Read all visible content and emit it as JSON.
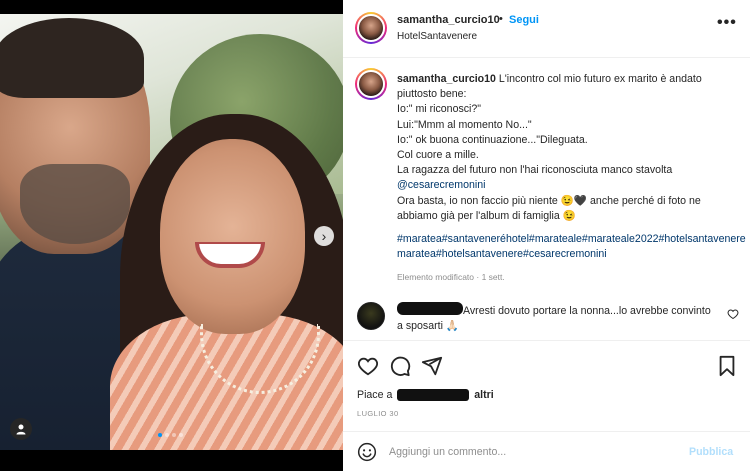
{
  "post": {
    "username": "samantha_curcio10",
    "separator": "•",
    "follow_label": "Segui",
    "location": "HotelSantavenere",
    "more_label": "•••"
  },
  "photo": {
    "carousel_dots": 4,
    "active_dot": 0
  },
  "caption": {
    "username": "samantha_curcio10",
    "line1": "L'incontro col mio futuro ex marito è andato piuttosto bene:",
    "line2": "Io:\" mi riconosci?\"",
    "line3": "Lui:\"Mmm al momento No...\"",
    "line4": "Io:\" ok buona continuazione...\"Dileguata.",
    "line5": "Col cuore a mille.",
    "line6": "La ragazza del futuro non l'hai riconosciuta manco stavolta",
    "mention": "@cesarecremonini",
    "line7": "Ora basta, io non faccio più niente 😉🖤 anche perché di foto ne abbiamo già per l'album di famiglia 😉",
    "hashtags": "#maratea#santaveneréhotel#marateale#marateale2022#hotelsantaveneremaratea#hotelsantavenere#cesarecremonini",
    "edited": "Elemento modificato · 1 sett."
  },
  "comment": {
    "text": "Avresti dovuto portare la nonna...lo avrebbe convinto a sposarti 🙏🏻"
  },
  "likes": {
    "prefix": "Piace a",
    "suffix": "altri"
  },
  "date": "LUGLIO 30",
  "add_comment": {
    "placeholder": "Aggiungi un commento...",
    "publish_label": "Pubblica"
  },
  "colors": {
    "accent": "#0095f6",
    "hashtag": "#00376b",
    "muted": "#8e8e8e",
    "publish_disabled": "#b2dffc"
  }
}
